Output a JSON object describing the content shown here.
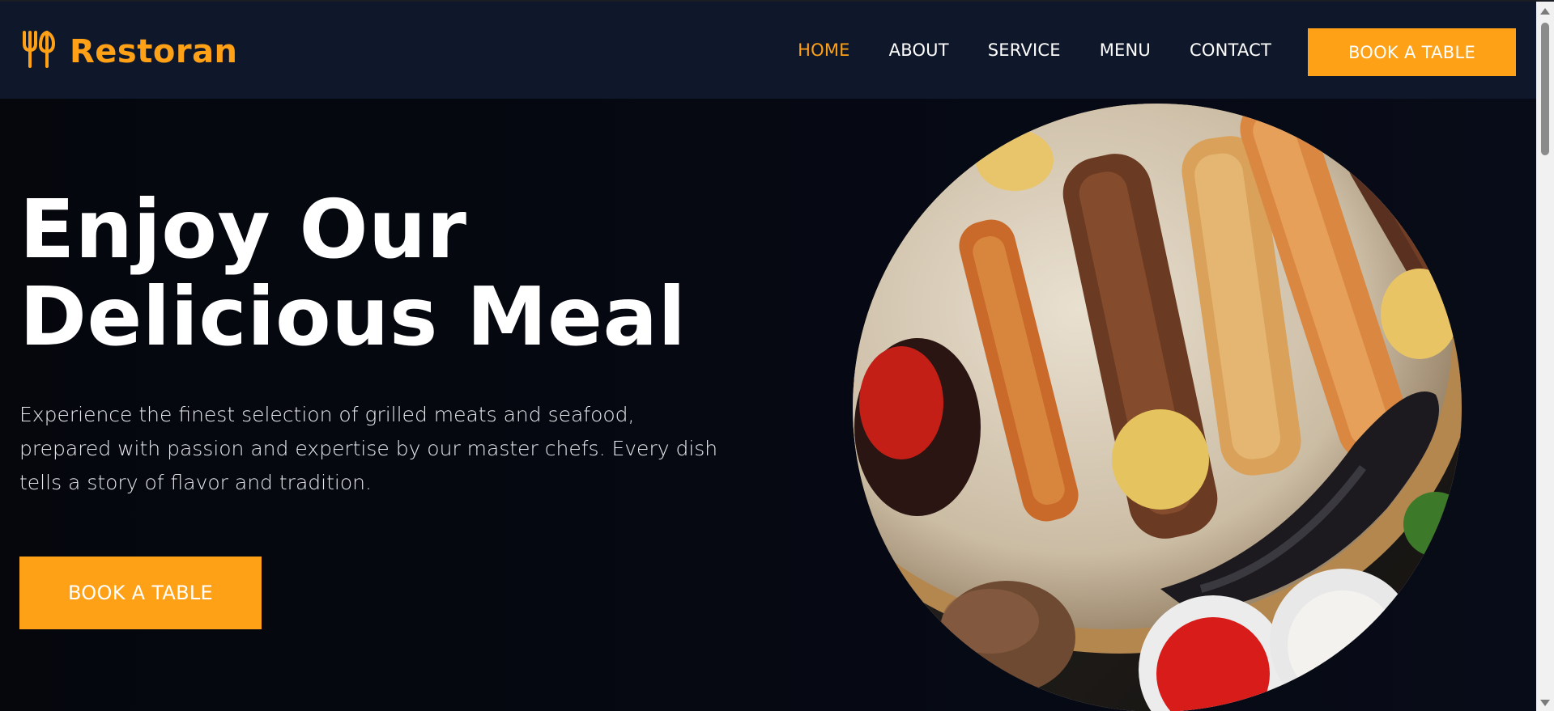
{
  "brand": {
    "icon": "utensils-icon",
    "name": "Restoran"
  },
  "nav": {
    "items": [
      {
        "label": "HOME",
        "active": true
      },
      {
        "label": "ABOUT",
        "active": false
      },
      {
        "label": "SERVICE",
        "active": false
      },
      {
        "label": "MENU",
        "active": false
      },
      {
        "label": "CONTACT",
        "active": false
      }
    ],
    "cta_label": "BOOK A TABLE"
  },
  "hero": {
    "title_line1": "Enjoy Our",
    "title_line2": "Delicious Meal",
    "description": "Experience the finest selection of grilled meats and seafood, prepared with passion and expertise by our master chefs. Every dish tells a story of flavor and tradition.",
    "cta_label": "BOOK A TABLE",
    "image_icon": "grilled-food-platter-image"
  },
  "colors": {
    "accent": "#fea116",
    "navbar_bg": "#0f172b",
    "page_bg": "#06080f",
    "text": "#ffffff"
  }
}
